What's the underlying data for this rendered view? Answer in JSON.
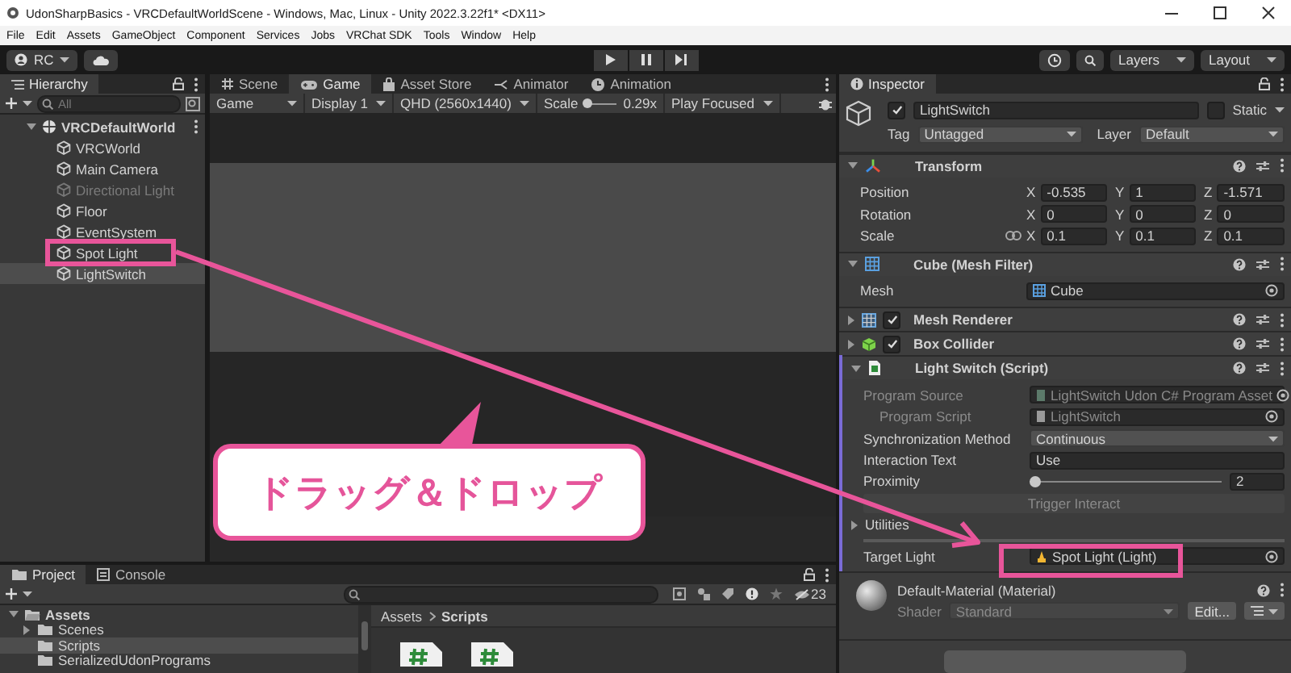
{
  "window": {
    "title": "UdonSharpBasics - VRCDefaultWorldScene - Windows, Mac, Linux - Unity 2022.3.22f1* <DX11>"
  },
  "menu": [
    "File",
    "Edit",
    "Assets",
    "GameObject",
    "Component",
    "Services",
    "Jobs",
    "VRChat SDK",
    "Tools",
    "Window",
    "Help"
  ],
  "toolbar": {
    "account": "RC",
    "dropdowns": [
      "Layers",
      "Layout"
    ]
  },
  "hierarchy": {
    "title": "Hierarchy",
    "search": {
      "placeholder": "All"
    },
    "items": [
      {
        "name": "VRCDefaultWorld",
        "expanded": true,
        "selected": false,
        "disabled": false,
        "children": [
          {
            "name": "VRCWorld",
            "selected": false,
            "disabled": false
          },
          {
            "name": "Main Camera",
            "selected": false,
            "disabled": false
          },
          {
            "name": "Directional Light",
            "selected": false,
            "disabled": true
          },
          {
            "name": "Floor",
            "selected": false,
            "disabled": false
          },
          {
            "name": "EventSystem",
            "selected": false,
            "disabled": false
          },
          {
            "name": "Spot Light",
            "selected": false,
            "disabled": false
          },
          {
            "name": "LightSwitch",
            "selected": true,
            "disabled": false
          }
        ]
      }
    ]
  },
  "game_panel": {
    "tabs": [
      {
        "label": "Scene",
        "selected": false
      },
      {
        "label": "Game",
        "selected": true
      },
      {
        "label": "Asset Store",
        "selected": false
      },
      {
        "label": "Animator",
        "selected": false
      },
      {
        "label": "Animation",
        "selected": false
      }
    ],
    "controls": [
      {
        "kind": "dropdown",
        "label": "Game"
      },
      {
        "kind": "dropdown",
        "label": "Display 1"
      },
      {
        "kind": "dropdown",
        "label": "QHD (2560x1440)"
      },
      {
        "kind": "slider",
        "label": "Scale",
        "level": 0.1,
        "reading": "0.29x"
      },
      {
        "kind": "dropdown",
        "label": "Play Focused"
      }
    ]
  },
  "inspector": {
    "title": "Inspector",
    "object": {
      "active": true,
      "name": "LightSwitch",
      "static": false,
      "static_label": "Static",
      "tag_label": "Tag",
      "tag": "Untagged",
      "layer_label": "Layer",
      "layer": "Default"
    },
    "components": [
      {
        "kind": "transform",
        "title": "Transform",
        "expanded": true,
        "rows": [
          {
            "label": "Position",
            "linked": false,
            "values": [
              {
                "axis": "X",
                "value": "-0.535"
              },
              {
                "axis": "Y",
                "value": "1"
              },
              {
                "axis": "Z",
                "value": "-1.571"
              }
            ]
          },
          {
            "label": "Rotation",
            "linked": false,
            "values": [
              {
                "axis": "X",
                "value": "0"
              },
              {
                "axis": "Y",
                "value": "0"
              },
              {
                "axis": "Z",
                "value": "0"
              }
            ]
          },
          {
            "label": "Scale",
            "linked": true,
            "values": [
              {
                "axis": "X",
                "value": "0.1"
              },
              {
                "axis": "Y",
                "value": "0.1"
              },
              {
                "axis": "Z",
                "value": "0.1"
              }
            ]
          }
        ]
      },
      {
        "kind": "mesh-filter",
        "title": "Cube (Mesh Filter)",
        "expanded": true,
        "fields": [
          {
            "kind": "mesh",
            "label": "Mesh",
            "value": "Cube",
            "disabled": false
          }
        ]
      },
      {
        "kind": "mesh-renderer",
        "title": "Mesh Renderer",
        "expanded": false,
        "enabled": true
      },
      {
        "kind": "box-collider",
        "title": "Box Collider",
        "expanded": false,
        "enabled": true
      },
      {
        "kind": "script",
        "title": "Light Switch (Script)",
        "expanded": true,
        "fields": [
          {
            "kind": "asset",
            "label": "Program Source",
            "value": "LightSwitch Udon C# Program Asset",
            "disabled": true
          },
          {
            "kind": "script",
            "label": "Program Script",
            "value": "LightSwitch",
            "disabled": true
          },
          {
            "kind": "dropdown",
            "label": "Synchronization Method",
            "value": "Continuous",
            "disabled": false
          },
          {
            "kind": "text",
            "label": "Interaction Text",
            "value": "Use",
            "disabled": false
          },
          {
            "kind": "slider",
            "label": "Proximity",
            "level": 0,
            "value": "2",
            "disabled": false
          },
          {
            "kind": "button",
            "label": "Trigger Interact",
            "disabled": true
          },
          {
            "kind": "foldout",
            "label": "Utilities",
            "expanded": false
          }
        ],
        "user_fields": [
          {
            "kind": "light",
            "label": "Target Light",
            "value": "Spot Light (Light)",
            "disabled": false
          }
        ]
      },
      {
        "kind": "material",
        "title": "Default-Material (Material)",
        "shader_label": "Shader",
        "shader": "Standard",
        "edit_button": "Edit..."
      }
    ]
  },
  "project": {
    "tabs": [
      {
        "label": "Project",
        "selected": true
      },
      {
        "label": "Console",
        "selected": false
      }
    ],
    "hidden_count": "23",
    "tree": [
      {
        "name": "Assets",
        "expanded": true,
        "selected": false,
        "children": [
          {
            "name": "Scenes",
            "expanded": false,
            "selected": false
          },
          {
            "name": "Scripts",
            "selected": true
          },
          {
            "name": "SerializedUdonPrograms",
            "selected": false
          }
        ]
      }
    ],
    "breadcrumb": [
      "Assets",
      "Scripts"
    ],
    "files": [
      {
        "kind": "csharp"
      },
      {
        "kind": "csharp"
      }
    ]
  },
  "annotation": {
    "callout": "ドラッグ＆ドロップ"
  }
}
